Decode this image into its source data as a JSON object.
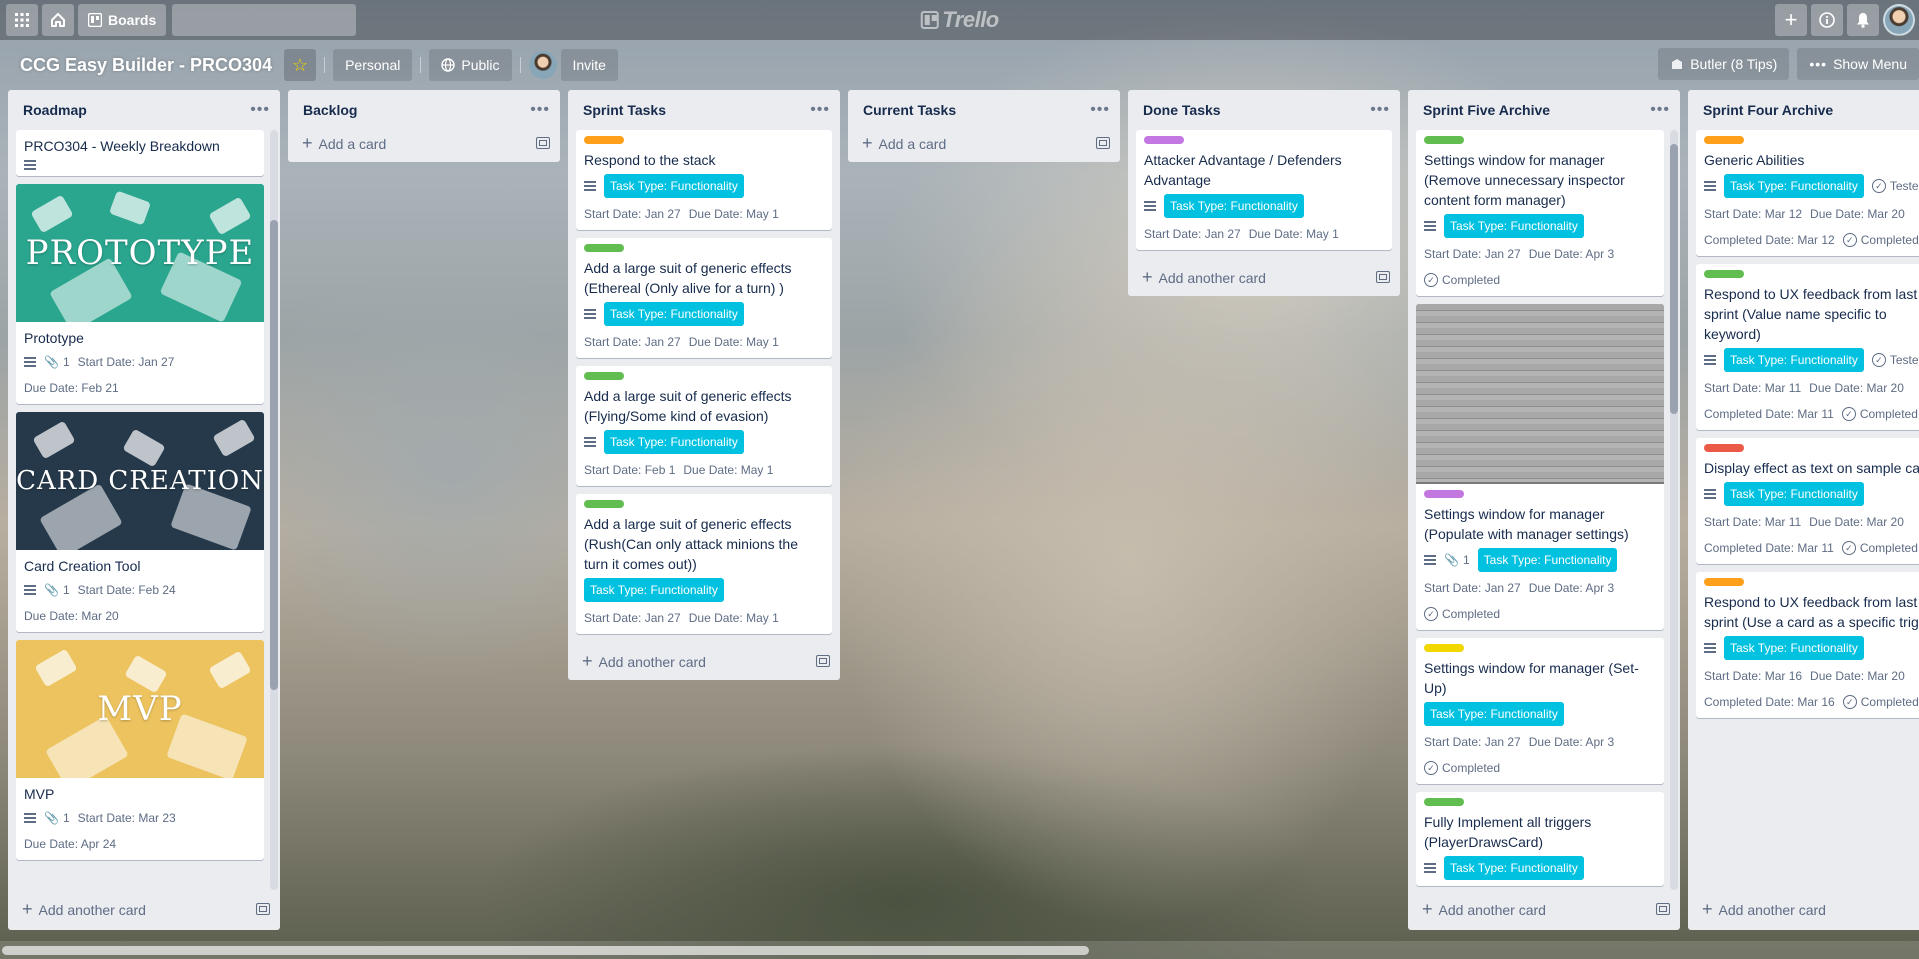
{
  "topbar": {
    "apps_icon": "grid-icon",
    "home_icon": "home-icon",
    "boards_label": "Boards",
    "search_placeholder": "",
    "logo_text": "Trello",
    "right_icons": [
      "plus-icon",
      "info-icon",
      "bell-icon",
      "avatar"
    ]
  },
  "board": {
    "title": "CCG Easy Builder - PRCO304",
    "visibility_team": "Personal",
    "visibility": "Public",
    "invite_label": "Invite",
    "butler_label": "Butler (8 Tips)",
    "show_menu_label": "Show Menu"
  },
  "colors": {
    "label_orange": "#ff9f1a",
    "label_green": "#61bd4f",
    "label_purple": "#c377e0",
    "label_yellow": "#f2d600",
    "label_red": "#eb5a46",
    "task_pill": "#00c2e0"
  },
  "lists": {
    "roadmap": {
      "title": "Roadmap",
      "add_label": "Add another card",
      "cards": [
        {
          "title": "PRCO304 - Weekly Breakdown"
        },
        {
          "cover_text": "PROTOTYPE",
          "title": "Prototype",
          "attachments": "1",
          "start": "Start Date: Jan 27",
          "due": "Due Date: Feb 21"
        },
        {
          "cover_text": "CARD CREATION",
          "title": "Card Creation Tool",
          "attachments": "1",
          "start": "Start Date: Feb 24",
          "due": "Due Date: Mar 20"
        },
        {
          "cover_text": "MVP",
          "title": "MVP",
          "attachments": "1",
          "start": "Start Date: Mar 23",
          "due": "Due Date: Apr 24"
        }
      ]
    },
    "backlog": {
      "title": "Backlog",
      "add_label": "Add a card"
    },
    "sprint_tasks": {
      "title": "Sprint Tasks",
      "add_label": "Add another card",
      "cards": [
        {
          "title": "Respond to the stack",
          "pill": "Task Type: Functionality",
          "start": "Start Date: Jan 27",
          "due": "Due Date: May 1"
        },
        {
          "title": "Add a large suit of generic effects (Ethereal (Only alive for a turn) )",
          "pill": "Task Type: Functionality",
          "start": "Start Date: Jan 27",
          "due": "Due Date: May 1"
        },
        {
          "title": "Add a large suit of generic effects (Flying/Some kind of evasion)",
          "pill": "Task Type: Functionality",
          "start": "Start Date: Feb 1",
          "due": "Due Date: May 1"
        },
        {
          "title": "Add a large suit of generic effects (Rush(Can only attack minions the turn it comes out))",
          "pill": "Task Type: Functionality",
          "start": "Start Date: Jan 27",
          "due": "Due Date: May 1"
        }
      ]
    },
    "current_tasks": {
      "title": "Current Tasks",
      "add_label": "Add a card"
    },
    "done_tasks": {
      "title": "Done Tasks",
      "add_label": "Add another card",
      "cards": [
        {
          "title": "Attacker Advantage / Defenders Advantage",
          "pill": "Task Type: Functionality",
          "start": "Start Date: Jan 27",
          "due": "Due Date: May 1"
        }
      ]
    },
    "sprint_five": {
      "title": "Sprint Five Archive",
      "add_label": "Add another card",
      "cards": [
        {
          "title": "Settings window for manager (Remove unnecessary inspector content form manager)",
          "pill": "Task Type: Functionality",
          "start": "Start Date: Jan 27",
          "due": "Due Date: Apr 3",
          "status": "Completed"
        },
        {
          "title": "Settings window for manager (Populate with manager settings)",
          "attachments": "1",
          "pill": "Task Type: Functionality",
          "start": "Start Date: Jan 27",
          "due": "Due Date: Apr 3",
          "status": "Completed"
        },
        {
          "title": "Settings window for manager (Set-Up)",
          "pill": "Task Type: Functionality",
          "start": "Start Date: Jan 27",
          "due": "Due Date: Apr 3",
          "status": "Completed"
        },
        {
          "title": "Fully Implement all triggers (PlayerDrawsCard)",
          "pill": "Task Type: Functionality"
        }
      ]
    },
    "sprint_four": {
      "title": "Sprint Four Archive",
      "add_label": "Add another card",
      "cards": [
        {
          "title": "Generic Abilities",
          "pill": "Task Type: Functionality",
          "tested": "Tested",
          "start": "Start Date: Mar 12",
          "due": "Due Date: Mar 20",
          "completed_date": "Completed Date: Mar 12",
          "status": "Completed"
        },
        {
          "title": "Respond to UX feedback from last sprint (Value name specific to keyword)",
          "pill": "Task Type: Functionality",
          "tested": "Tested",
          "start": "Start Date: Mar 11",
          "due": "Due Date: Mar 20",
          "completed_date": "Completed Date: Mar 11",
          "status": "Completed"
        },
        {
          "title": "Display effect as text on sample card",
          "pill": "Task Type: Functionality",
          "start": "Start Date: Mar 11",
          "due": "Due Date: Mar 20",
          "completed_date": "Completed Date: Mar 11",
          "status": "Completed"
        },
        {
          "title": "Respond to UX feedback from last sprint (Use a card as a specific trigger)",
          "pill": "Task Type: Functionality",
          "start": "Start Date: Mar 16",
          "due": "Due Date: Mar 20",
          "completed_date": "Completed Date: Mar 16",
          "status": "Completed"
        }
      ]
    }
  }
}
